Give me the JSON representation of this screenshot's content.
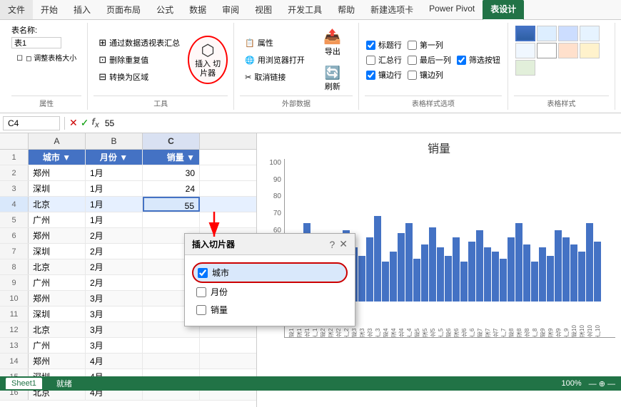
{
  "tabs": [
    "文件",
    "开始",
    "插入",
    "页面布局",
    "公式",
    "数据",
    "审阅",
    "视图",
    "开发工具",
    "帮助",
    "新建选项卡",
    "Power Pivot",
    "表设计"
  ],
  "activeTab": "表设计",
  "ribbon": {
    "group_property": {
      "label": "属性",
      "table_name_label": "表名称:",
      "table_name_value": "表1",
      "resize_label": "◻ 调整表格大小"
    },
    "group_tools": {
      "label": "工具",
      "btn_pivot": "通过数据透视表汇总",
      "btn_dedup": "删除重复值",
      "btn_convert": "转换为区域",
      "btn_slicer": "插入\n切片器",
      "btn_slicer_icon": "⬡"
    },
    "group_export": {
      "label": "外部数据",
      "btn_export": "导出",
      "btn_refresh": "刷新",
      "btn_open_browser": "用浏览器打开",
      "btn_unlink": "取消链接",
      "btn_properties": "属性"
    },
    "group_style_options": {
      "label": "表格样式选项",
      "chk_header_row": "标题行",
      "chk_first_col": "第一列",
      "chk_filter_btn": "筛选按钮",
      "chk_total_row": "汇总行",
      "chk_last_col": "最后一列",
      "chk_banded_rows": "镶边行",
      "chk_banded_cols": "镶边列"
    }
  },
  "formula_bar": {
    "cell_ref": "C4",
    "formula": "55"
  },
  "spreadsheet": {
    "col_headers": [
      "A",
      "B",
      "C",
      ""
    ],
    "rows": [
      {
        "num": 1,
        "cells": [
          "城市",
          "月份",
          "销量",
          ""
        ]
      },
      {
        "num": 2,
        "cells": [
          "郑州",
          "1月",
          "30",
          ""
        ]
      },
      {
        "num": 3,
        "cells": [
          "深圳",
          "1月",
          "24",
          ""
        ]
      },
      {
        "num": 4,
        "cells": [
          "北京",
          "1月",
          "55",
          ""
        ],
        "selected_col": 2
      },
      {
        "num": 5,
        "cells": [
          "广州",
          "1月",
          "",
          ""
        ]
      },
      {
        "num": 6,
        "cells": [
          "郑州",
          "2月",
          "",
          ""
        ]
      },
      {
        "num": 7,
        "cells": [
          "深圳",
          "2月",
          "",
          ""
        ]
      },
      {
        "num": 8,
        "cells": [
          "北京",
          "2月",
          "",
          ""
        ]
      },
      {
        "num": 9,
        "cells": [
          "广州",
          "2月",
          "",
          ""
        ]
      },
      {
        "num": 10,
        "cells": [
          "郑州",
          "3月",
          "",
          ""
        ]
      },
      {
        "num": 11,
        "cells": [
          "深圳",
          "3月",
          "",
          ""
        ]
      },
      {
        "num": 12,
        "cells": [
          "北京",
          "3月",
          "",
          ""
        ]
      },
      {
        "num": 13,
        "cells": [
          "广州",
          "3月",
          "",
          ""
        ]
      },
      {
        "num": 14,
        "cells": [
          "郑州",
          "4月",
          "",
          ""
        ]
      },
      {
        "num": 15,
        "cells": [
          "深圳",
          "4月",
          "",
          ""
        ]
      },
      {
        "num": 16,
        "cells": [
          "北京",
          "4月",
          "",
          ""
        ]
      }
    ]
  },
  "chart": {
    "title": "销量",
    "y_labels": [
      "100",
      "90"
    ],
    "bars": [
      25,
      40,
      55,
      30,
      35,
      28,
      42,
      50,
      38,
      32,
      45,
      60,
      28,
      35,
      48,
      55,
      30,
      40,
      52,
      38,
      32,
      45,
      28,
      42,
      50,
      38,
      35,
      30,
      45,
      55,
      40,
      28,
      38,
      32,
      50,
      45,
      40,
      35,
      55,
      42
    ],
    "x_labels": [
      "郑1",
      "深1",
      "北1",
      "广1",
      "郑2",
      "深2",
      "北2",
      "广2",
      "郑3",
      "深3",
      "北3",
      "广3",
      "郑4",
      "深4",
      "北4",
      "广4",
      "郑5",
      "深5",
      "北5",
      "广5",
      "郑6",
      "深6",
      "北6",
      "广6",
      "郑7",
      "深7",
      "北7",
      "广7",
      "郑8",
      "深8",
      "北8",
      "广8",
      "郑9",
      "深9",
      "北9",
      "广9",
      "郑10",
      "深10",
      "北10",
      "广10"
    ]
  },
  "dialog": {
    "title": "插入切片器",
    "help_btn": "?",
    "close_btn": "✕",
    "items": [
      {
        "label": "城市",
        "checked": true
      },
      {
        "label": "月份",
        "checked": false
      },
      {
        "label": "销量",
        "checked": false
      }
    ]
  },
  "status_bar": {
    "sheet": "Sheet1",
    "zoom": "100%"
  }
}
